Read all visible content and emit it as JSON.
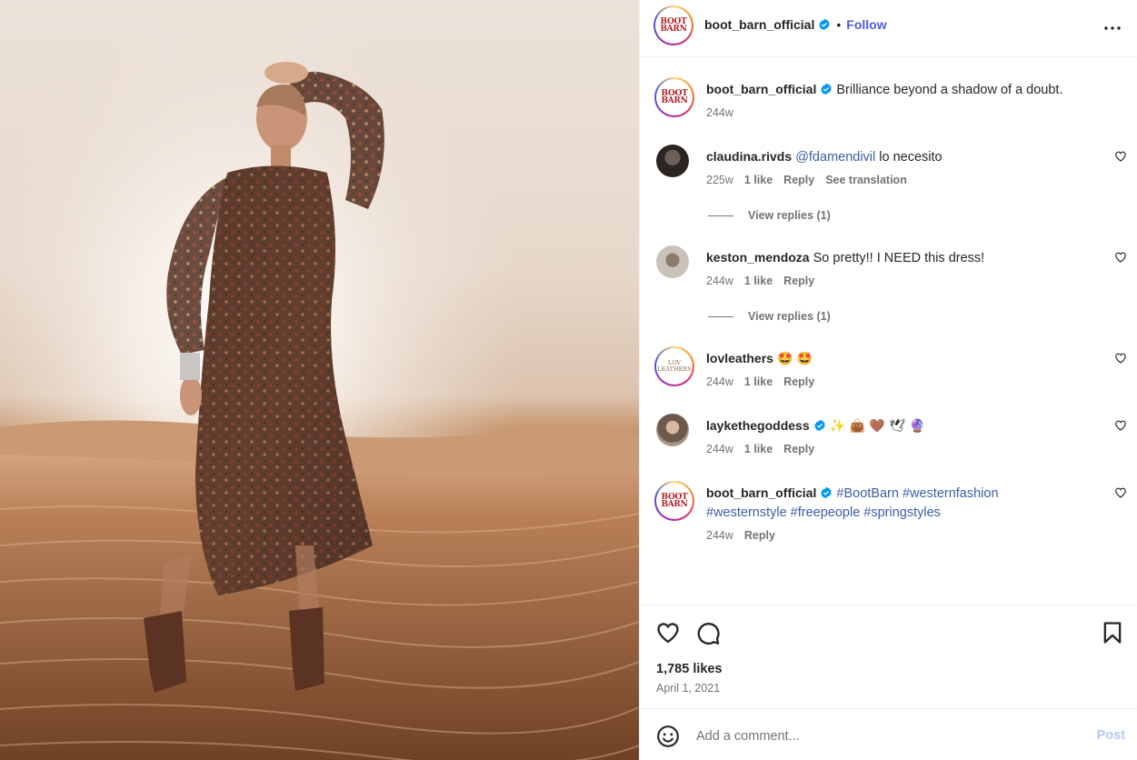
{
  "post": {
    "username": "boot_barn_official",
    "follow_label": "Follow",
    "separator": "•",
    "logo_text": "BOOT BARN",
    "image_alt_icon": "desert-model-photo"
  },
  "caption": {
    "username": "boot_barn_official",
    "text": "Brilliance beyond a shadow of a doubt.",
    "time": "244w"
  },
  "comments": [
    {
      "username": "claudina.rivds",
      "mention": "@fdamendivil",
      "text": " lo necesito",
      "time": "225w",
      "likes": "1 like",
      "reply": "Reply",
      "translate": "See translation",
      "view_replies": "View replies (1)"
    },
    {
      "username": "keston_mendoza",
      "text": "So pretty!! I NEED this dress!",
      "time": "244w",
      "likes": "1 like",
      "reply": "Reply",
      "view_replies": "View replies (1)"
    },
    {
      "username": "lovleathers",
      "text": "🤩 🤩",
      "time": "244w",
      "likes": "1 like",
      "reply": "Reply",
      "logo_text": "LOV LEATHERS"
    },
    {
      "username": "laykethegoddess",
      "text": "✨ 👜 🤎 🕊 🔮",
      "time": "244w",
      "likes": "1 like",
      "reply": "Reply"
    },
    {
      "username": "boot_barn_official",
      "tags_line1": "#BootBarn #westernfashion",
      "tags_line2": "#westernstyle #freepeople #springstyles",
      "time": "244w",
      "reply": "Reply"
    }
  ],
  "footer": {
    "likes": "1,785 likes",
    "date": "April 1, 2021",
    "comment_placeholder": "Add a comment...",
    "post_label": "Post"
  },
  "colors": {
    "link": "#4f5bd5",
    "hashtag": "#3b5ea8",
    "verified": "#0095f6",
    "muted": "#737373",
    "post_disabled": "#b3c7f5",
    "brand_red": "#b41f24"
  },
  "icons": [
    "verified-icon",
    "more-icon",
    "heart-icon",
    "comment-icon",
    "bookmark-icon",
    "smile-icon"
  ]
}
